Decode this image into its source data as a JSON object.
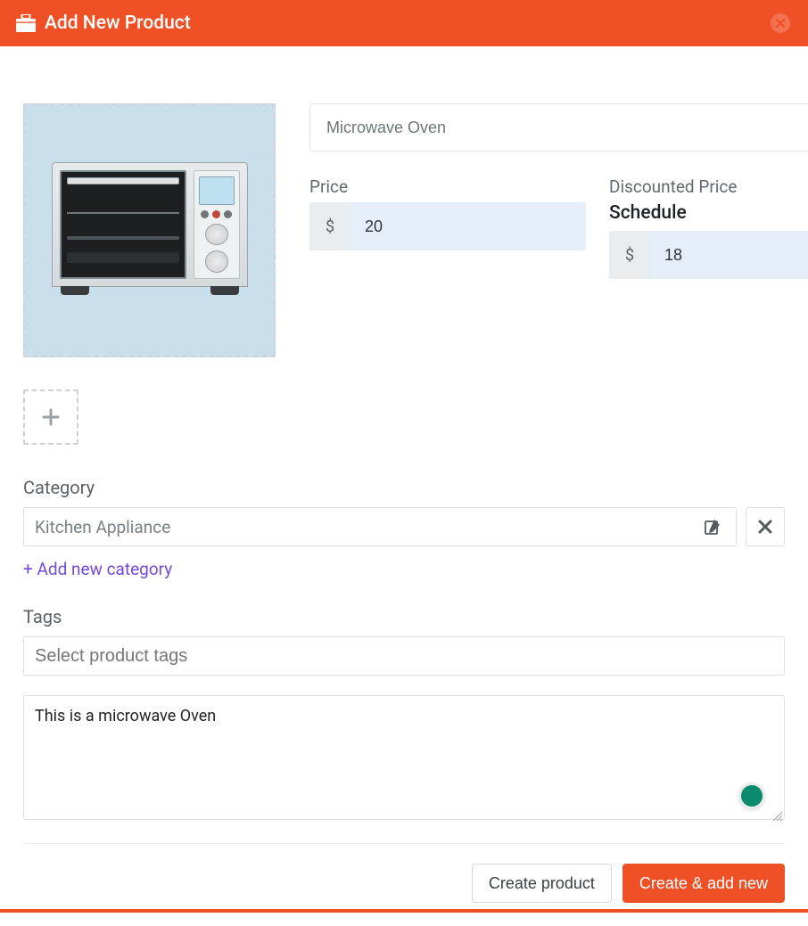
{
  "header": {
    "title": "Add New Product"
  },
  "product": {
    "name": "Microwave Oven",
    "image_alt": "microwave-oven-image"
  },
  "price": {
    "label": "Price",
    "currency_symbol": "$",
    "value": "20"
  },
  "discounted": {
    "label": "Discounted Price",
    "schedule_label": "Schedule",
    "currency_symbol": "$",
    "value": "18"
  },
  "category": {
    "label": "Category",
    "selected": "Kitchen Appliance",
    "add_new_label": "+ Add new category"
  },
  "tags": {
    "label": "Tags",
    "placeholder": "Select product tags"
  },
  "description": {
    "value": "This is a microwave Oven"
  },
  "footer": {
    "create_label": "Create product",
    "create_add_label": "Create & add new"
  },
  "colors": {
    "accent": "#f05025",
    "link": "#714be0",
    "input_bg": "#e5eef9"
  }
}
